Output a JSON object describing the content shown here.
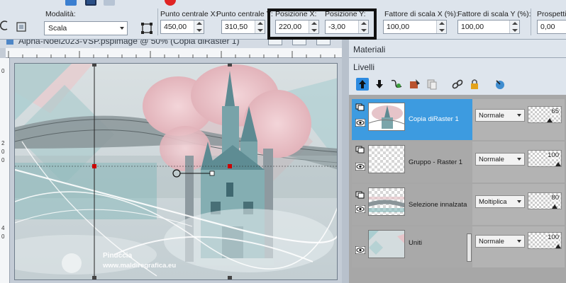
{
  "toolbar": {
    "mode_label": "Modalità:",
    "mode_value": "Scala",
    "center_x_label": "Punto centrale X:",
    "center_x_value": "450,00",
    "center_y_label": "Punto centrale Y:",
    "center_y_value": "310,50",
    "pos_x_label": "Posizione X:",
    "pos_x_value": "220,00",
    "pos_y_label": "Posizione Y:",
    "pos_y_value": "-3,00",
    "scale_x_label": "Fattore di scala X (%):",
    "scale_x_value": "100,00",
    "scale_y_label": "Fattore di scala Y (%):",
    "scale_y_value": "100,00",
    "persp_label": "Prospettiv",
    "persp_value": "0,00"
  },
  "image_window": {
    "title": "Alpha-Noel2023-VSP.pspimage  @  50% (Copia diRaster 1)",
    "watermark_name": "Pinuccia",
    "watermark_url": "www.maldiregrafica.eu",
    "ruler_left_numbers": [
      "0",
      "2",
      "0",
      "0",
      "4",
      "0"
    ]
  },
  "panels": {
    "materials_title": "Materiali",
    "layers_title": "Livelli"
  },
  "layers": [
    {
      "name": "Copia diRaster 1",
      "blend": "Normale",
      "opacity": "65",
      "opacity_level": 0.65,
      "selected": true
    },
    {
      "name": "Gruppo - Raster 1",
      "blend": "Normale",
      "opacity": "100",
      "opacity_level": 1.0,
      "selected": false
    },
    {
      "name": "Selezione innalzata",
      "blend": "Moltiplica",
      "opacity": "80",
      "opacity_level": 0.8,
      "selected": false
    },
    {
      "name": "Uniti",
      "blend": "Normale",
      "opacity": "100",
      "opacity_level": 1.0,
      "selected": false
    }
  ],
  "colors": {
    "selected_layer": "#3d9be0",
    "highlight_border": "#111111"
  }
}
